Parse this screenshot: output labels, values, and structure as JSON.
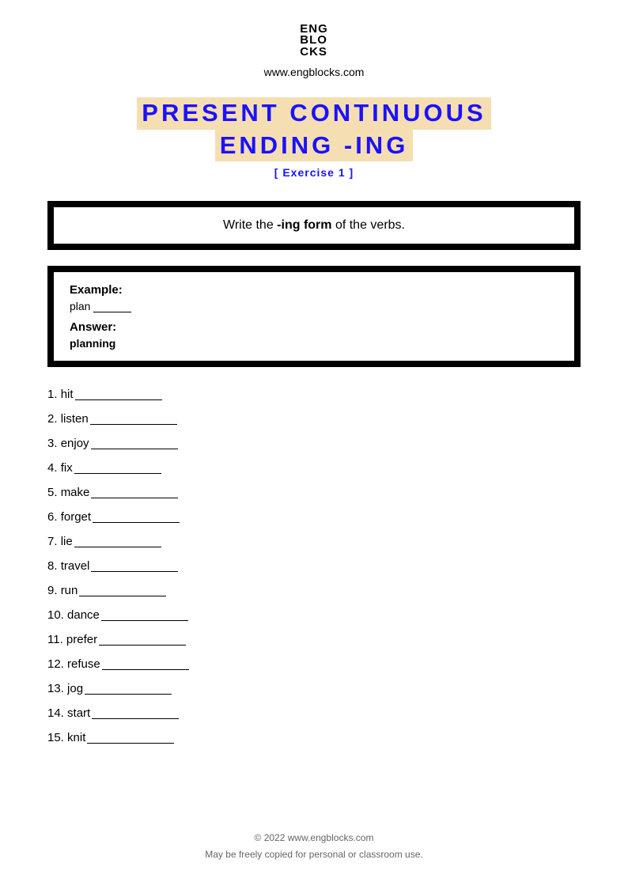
{
  "header": {
    "logo_line1": "ENG",
    "logo_line2": "BLO",
    "logo_line3": "CKS",
    "site_url": "www.engblocks.com"
  },
  "title": {
    "line1": "PRESENT CONTINUOUS",
    "line2": "ENDING -ING",
    "subtitle": "[ Exercise 1 ]"
  },
  "instruction": {
    "prefix": "Write the ",
    "bold": "-ing form",
    "suffix": " of the verbs."
  },
  "example": {
    "label_example": "Example:",
    "verb": "plan",
    "label_answer": "Answer:",
    "answer": "planning"
  },
  "items": [
    {
      "num": "1.",
      "verb": "hit"
    },
    {
      "num": "2.",
      "verb": "listen"
    },
    {
      "num": "3.",
      "verb": "enjoy"
    },
    {
      "num": "4.",
      "verb": "fix"
    },
    {
      "num": "5.",
      "verb": "make"
    },
    {
      "num": "6.",
      "verb": "forget"
    },
    {
      "num": "7.",
      "verb": "lie"
    },
    {
      "num": "8.",
      "verb": "travel"
    },
    {
      "num": "9.",
      "verb": "run"
    },
    {
      "num": "10.",
      "verb": "dance"
    },
    {
      "num": "11.",
      "verb": "prefer"
    },
    {
      "num": "12.",
      "verb": "refuse"
    },
    {
      "num": "13.",
      "verb": "jog"
    },
    {
      "num": "14.",
      "verb": "start"
    },
    {
      "num": "15.",
      "verb": "knit"
    }
  ],
  "footer": {
    "copyright": "© 2022 www.engblocks.com",
    "license": "May be freely copied for personal or classroom use."
  }
}
